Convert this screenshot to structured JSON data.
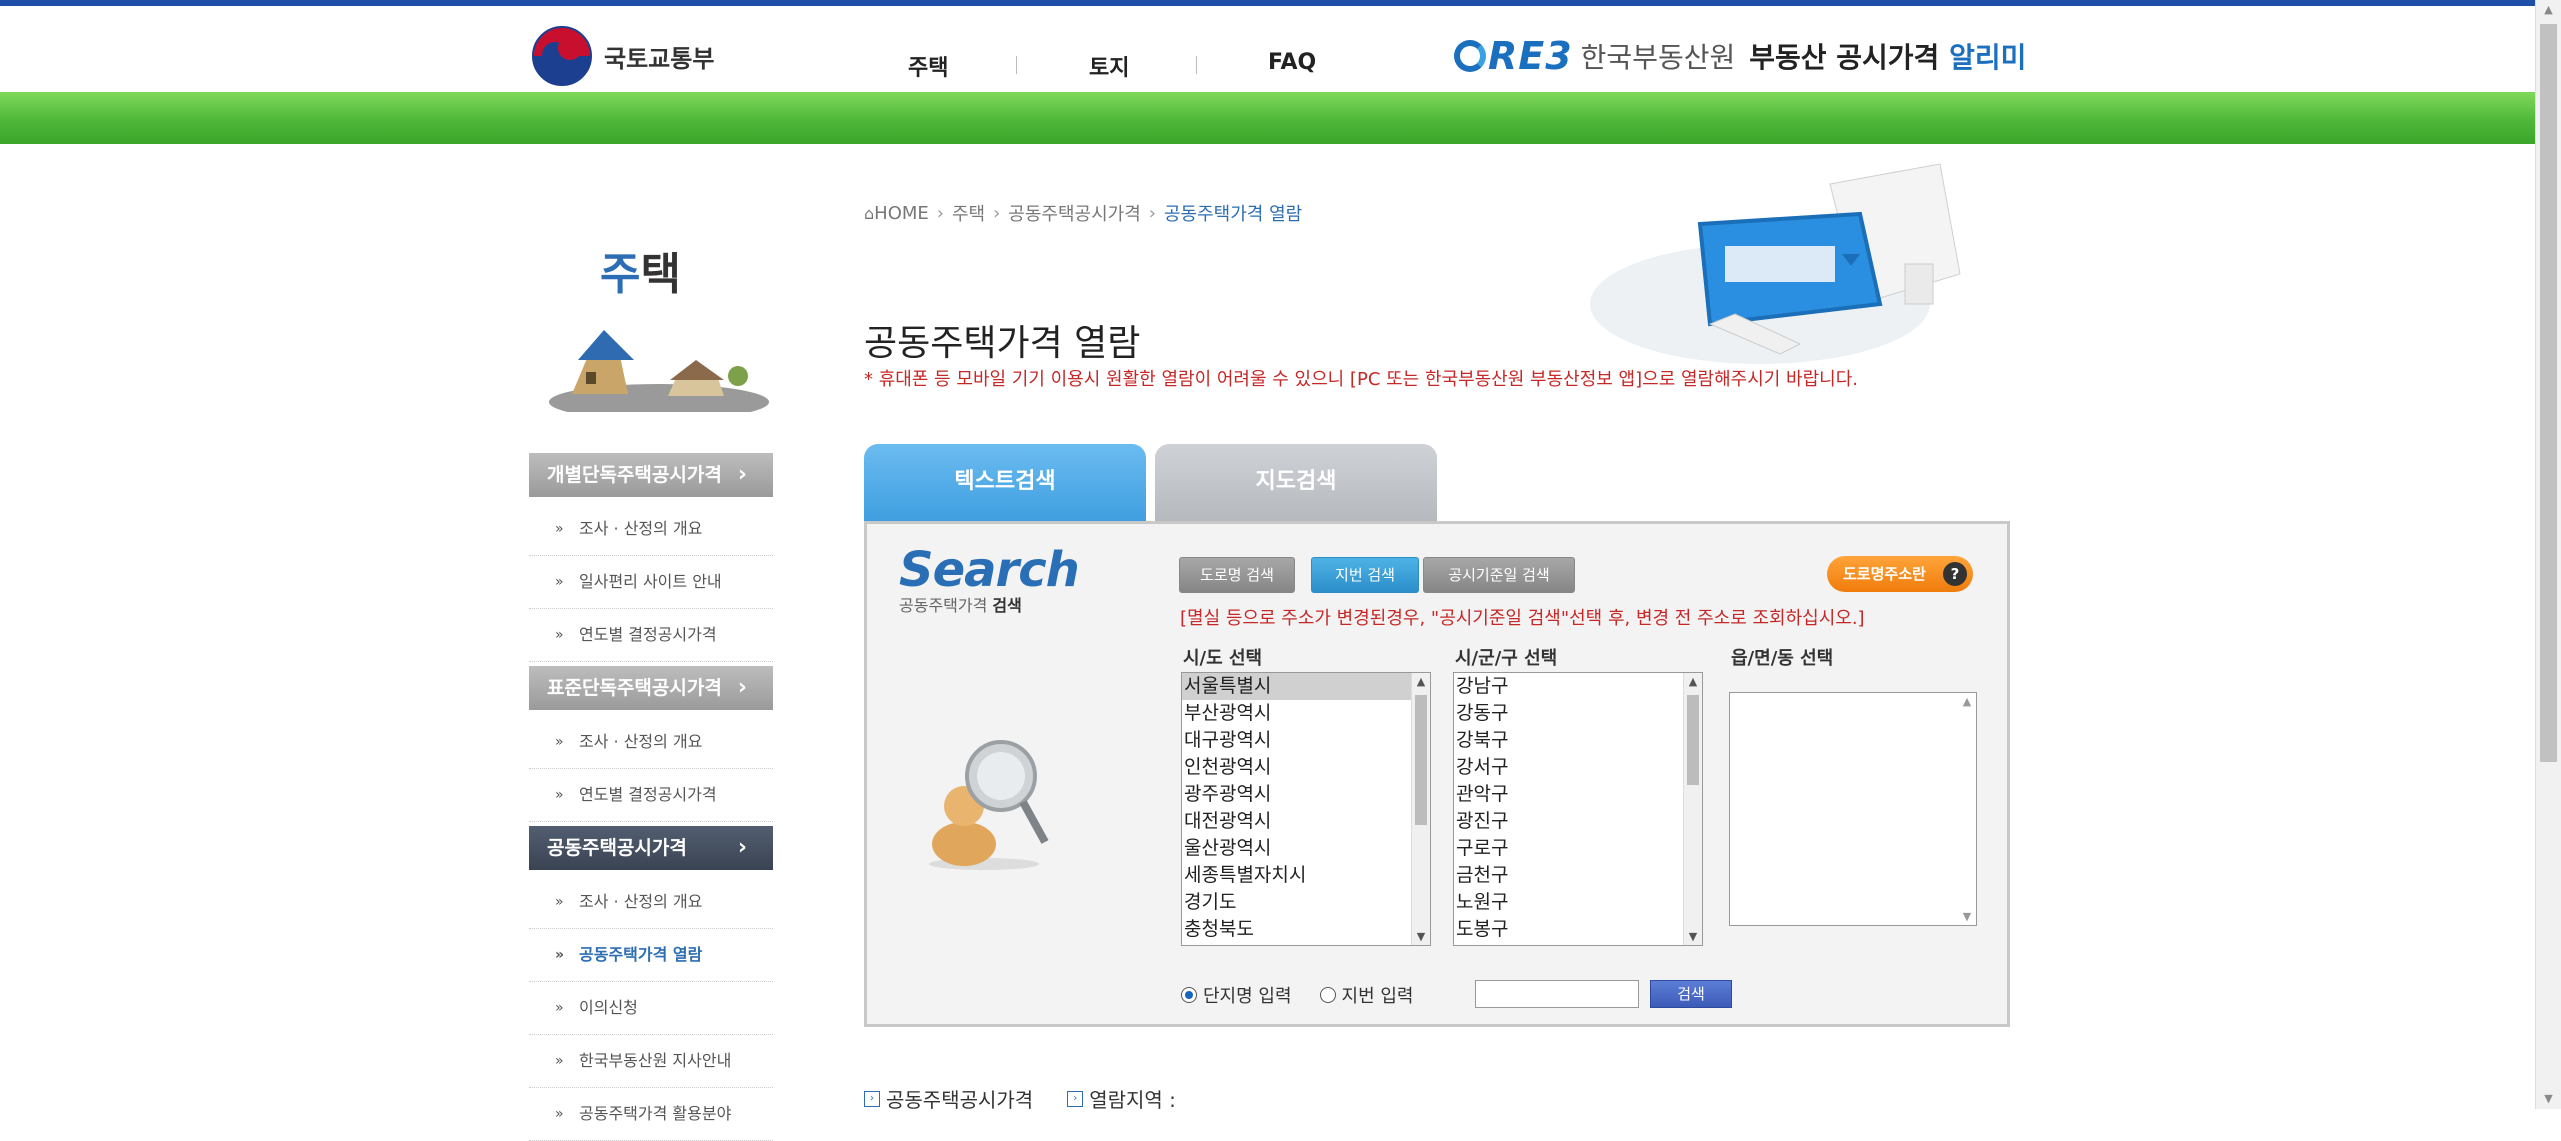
{
  "header": {
    "ministry": "국토교통부",
    "nav": [
      "주택",
      "토지",
      "FAQ"
    ],
    "reb_logo": "RE3",
    "reb_name": "한국부동산원",
    "service_name_prefix": "부동산 공시가격",
    "service_name_accent": "알리미"
  },
  "sidebar": {
    "title_accent": "주",
    "title_rest": "택",
    "groups": [
      {
        "label": "개별단독주택공시가격",
        "items": [
          "조사 · 산정의 개요",
          "일사편리 사이트 안내",
          "연도별 결정공시가격"
        ]
      },
      {
        "label": "표준단독주택공시가격",
        "items": [
          "조사 · 산정의 개요",
          "연도별 결정공시가격"
        ]
      },
      {
        "label": "공동주택공시가격",
        "items": [
          "조사 · 산정의 개요",
          "공동주택가격 열람",
          "이의신청",
          "한국부동산원 지사안내",
          "공동주택가격 활용분야"
        ]
      }
    ]
  },
  "breadcrumb": [
    "HOME",
    "주택",
    "공동주택공시가격",
    "공동주택가격 열람"
  ],
  "page": {
    "title": "공동주택가격 열람",
    "warning": "* 휴대폰 등 모바일 기기 이용시 원활한 열람이 어려울 수 있으니 [PC 또는 한국부동산원 부동산정보 앱]으로 열람해주시기 바랍니다."
  },
  "tabs": [
    "텍스트검색",
    "지도검색"
  ],
  "panel": {
    "logo_title": "Search",
    "logo_sub_prefix": "공동주택가격",
    "logo_sub_bold": "검색",
    "btn_road": "도로명 검색",
    "btn_jibun": "지번 검색",
    "btn_date": "공시기준일 검색",
    "btn_roadinfo": "도로명주소란",
    "notice": "[멸실 등으로 주소가 변경된경우, \"공시기준일 검색\"선택 후, 변경 전 주소로 조회하십시오.]",
    "label_sido": "시/도 선택",
    "label_sigungu": "시/군/구 선택",
    "label_eupmyeon": "읍/면/동 선택",
    "sido": [
      "서울특별시",
      "부산광역시",
      "대구광역시",
      "인천광역시",
      "광주광역시",
      "대전광역시",
      "울산광역시",
      "세종특별자치시",
      "경기도",
      "충청북도"
    ],
    "sigungu": [
      "강남구",
      "강동구",
      "강북구",
      "강서구",
      "관악구",
      "광진구",
      "구로구",
      "금천구",
      "노원구",
      "도봉구"
    ],
    "radio_danji": "단지명 입력",
    "radio_jibun": "지번 입력",
    "search_value": "",
    "btn_search": "검색"
  },
  "bottom_links": [
    "공동주택공시가격",
    "열람지역 :"
  ]
}
